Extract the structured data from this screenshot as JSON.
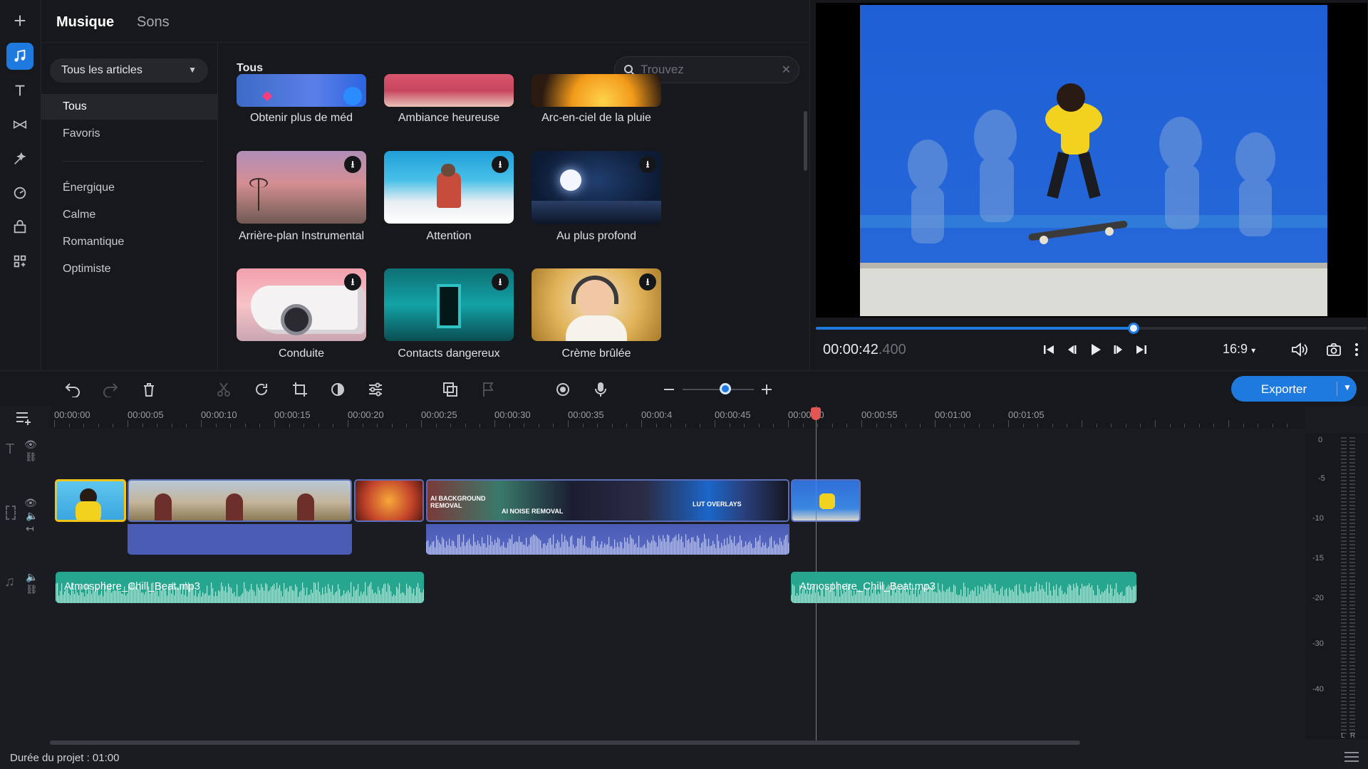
{
  "library": {
    "tabs": [
      "Musique",
      "Sons"
    ],
    "dropdown": "Tous les articles",
    "categories": [
      "Tous",
      "Favoris",
      "Énergique",
      "Calme",
      "Romantique",
      "Optimiste"
    ],
    "title": "Tous",
    "search_placeholder": "Trouvez",
    "items": [
      "Obtenir plus de méd",
      "Ambiance heureuse",
      "Arc-en-ciel de la pluie",
      "Arrière-plan Instrumental",
      "Attention",
      "Au plus profond",
      "Conduite",
      "Contacts dangereux",
      "Crème brûlée"
    ]
  },
  "player": {
    "time": "00:00:42",
    "time_ms": ".400",
    "progress": 0.576,
    "aspect": "16:9"
  },
  "toolbar": {
    "export_label": "Exporter"
  },
  "timeline": {
    "ticks": [
      "00:00:00",
      "00:00:05",
      "00:00:10",
      "00:00:15",
      "00:00:20",
      "00:00:25",
      "00:00:30",
      "00:00:35",
      "00:00:4",
      "00:00:45",
      "00:00:50",
      "00:00:55",
      "00:01:00",
      "00:01:05"
    ],
    "audio_clips": [
      "Atmosphere_Chill_Beat.mp3",
      "Atmosphere_Chill_Beat.mp3"
    ],
    "video_overlays": [
      "AI BACKGROUND REMOVAL",
      "AI NOISE REMOVAL",
      "LUT OVERLAYS"
    ],
    "meter_labels": [
      "0",
      "-5",
      "-10",
      "-15",
      "-20",
      "-30",
      "-40"
    ],
    "meter_channels": [
      "L",
      "R"
    ],
    "duration": "Durée du projet : 01:00"
  },
  "colors": {
    "accent": "#1f7ae0",
    "audio_clip": "#26a68f",
    "playhead": "#e25555",
    "background": "#17181c"
  }
}
